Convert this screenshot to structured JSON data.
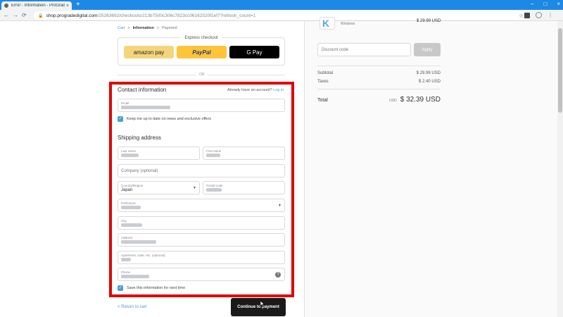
{
  "browser": {
    "tab_title": "Error - Information - ProGrade",
    "url_host": "shop.progradedigital.com",
    "url_path": "/25263692/checkouts/213b7500c306c7823cc06162520f1ef7?refresh_count=1"
  },
  "breadcrumb": {
    "cart": "Cart",
    "information": "Information",
    "payment": "Payment",
    "sep": ">"
  },
  "express": {
    "title": "Express checkout",
    "amazon": "amazon pay",
    "paypal": "PayPal",
    "gpay": "G Pay"
  },
  "or": "OR",
  "contact": {
    "title": "Contact information",
    "account_prompt": "Already have an account?",
    "login": "Log in",
    "email_label": "Email",
    "newsletter": "Keep me up to date on news and exclusive offers"
  },
  "shipping": {
    "title": "Shipping address",
    "last_name_label": "Last name",
    "first_name_label": "First name",
    "company_placeholder": "Company (optional)",
    "country_label": "Country/Region",
    "country_value": "Japan",
    "postal_label": "Postal code",
    "prefecture_label": "Prefecture",
    "city_label": "City",
    "address_label": "Address",
    "apartment_label": "Apartment, suite, etc. (optional)",
    "phone_label": "Phone",
    "save_info": "Save this information for next time"
  },
  "footer": {
    "return": "< Return to cart",
    "continue": "Continue to payment"
  },
  "summary": {
    "product_variant": "Windows",
    "product_price": "$ 29.99 USD",
    "discount_placeholder": "Discount code",
    "apply": "Apply",
    "subtotal_label": "Subtotal",
    "subtotal_value": "$ 29.99 USD",
    "taxes_label": "Taxes",
    "taxes_value": "$ 2.40 USD",
    "total_label": "Total",
    "currency": "USD",
    "total_value": "$ 32.39 USD"
  },
  "colors": {
    "accent": "#4c9ed3",
    "highlight": "#e10000",
    "tabbar": "#1e88e5"
  }
}
